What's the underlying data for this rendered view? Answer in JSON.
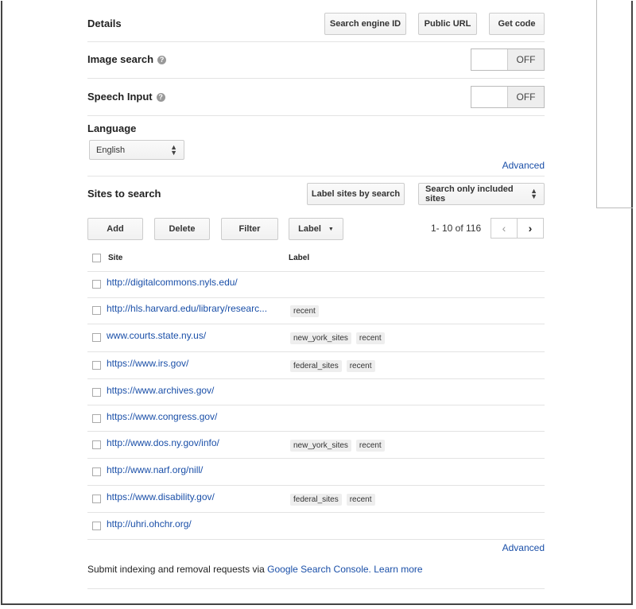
{
  "details": {
    "title": "Details",
    "search_engine_id_label": "Search engine ID",
    "public_url_label": "Public URL",
    "get_code_label": "Get code"
  },
  "image_search": {
    "label": "Image search",
    "state": "OFF"
  },
  "speech_input": {
    "label": "Speech Input",
    "state": "OFF"
  },
  "language": {
    "title": "Language",
    "selected": "English",
    "advanced_link": "Advanced"
  },
  "sites": {
    "title": "Sites to search",
    "label_sites_button": "Label sites by search",
    "scope_select": "Search only included sites",
    "add_label": "Add",
    "delete_label": "Delete",
    "filter_label": "Filter",
    "label_label": "Label",
    "pagination": "1- 10 of 116",
    "col_site": "Site",
    "col_label": "Label",
    "rows": [
      {
        "site": "http://digitalcommons.nyls.edu/",
        "labels": []
      },
      {
        "site": "http://hls.harvard.edu/library/researc...",
        "labels": [
          "recent"
        ]
      },
      {
        "site": "www.courts.state.ny.us/",
        "labels": [
          "new_york_sites",
          "recent"
        ]
      },
      {
        "site": "https://www.irs.gov/",
        "labels": [
          "federal_sites",
          "recent"
        ]
      },
      {
        "site": "https://www.archives.gov/",
        "labels": []
      },
      {
        "site": "https://www.congress.gov/",
        "labels": []
      },
      {
        "site": "http://www.dos.ny.gov/info/",
        "labels": [
          "new_york_sites",
          "recent"
        ]
      },
      {
        "site": "http://www.narf.org/nill/",
        "labels": []
      },
      {
        "site": "https://www.disability.gov/",
        "labels": [
          "federal_sites",
          "recent"
        ]
      },
      {
        "site": "http://uhri.ohchr.org/",
        "labels": []
      }
    ],
    "advanced_link": "Advanced"
  },
  "footer": {
    "prefix": "Submit indexing and removal requests via",
    "console_link": "Google Search Console.",
    "learn_more": "Learn more"
  }
}
